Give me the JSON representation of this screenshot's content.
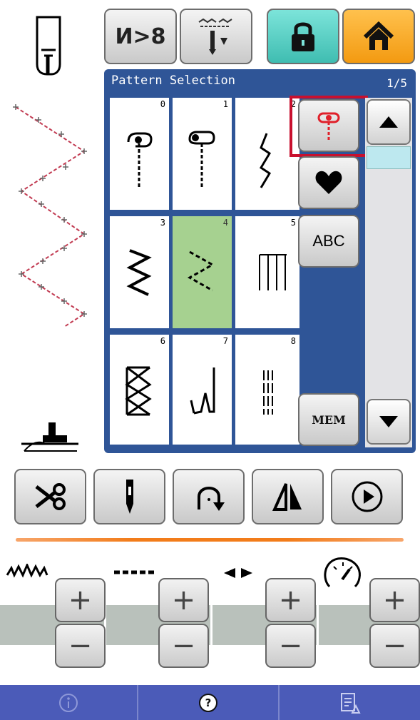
{
  "header": {
    "thread_cut_label": "И>8",
    "lock_color": "#4fd1c5",
    "home_color": "#f6a623"
  },
  "panel": {
    "title": "Pattern Selection",
    "page": "1/5",
    "patterns": [
      {
        "num": "0",
        "icon": "buttonhole-stitch-icon",
        "selected": false
      },
      {
        "num": "1",
        "icon": "keyhole-stitch-icon",
        "selected": false
      },
      {
        "num": "2",
        "icon": "lightning-stitch-icon",
        "selected": false
      },
      {
        "num": "3",
        "icon": "zigzag-stitch-icon",
        "selected": false
      },
      {
        "num": "4",
        "icon": "dashed-zigzag-stitch-icon",
        "selected": true
      },
      {
        "num": "5",
        "icon": "blind-hem-stitch-icon",
        "selected": false
      },
      {
        "num": "6",
        "icon": "overlock-stitch-icon",
        "selected": false
      },
      {
        "num": "7",
        "icon": "blind-stitch-icon",
        "selected": false
      },
      {
        "num": "8",
        "icon": "triple-straight-stitch-icon",
        "selected": false
      }
    ],
    "abc_label": "ABC",
    "mem_label": "MEM"
  },
  "controls": [
    {
      "name": "stitch-width",
      "icon": "zigzag-width-icon",
      "plus": "+",
      "minus": "−"
    },
    {
      "name": "stitch-length",
      "icon": "dash-length-icon",
      "plus": "+",
      "minus": "−"
    },
    {
      "name": "needle-position",
      "icon": "left-right-arrows-icon",
      "plus": "+",
      "minus": "−"
    },
    {
      "name": "speed",
      "icon": "speedometer-icon",
      "plus": "+",
      "minus": "−"
    }
  ],
  "footer": {
    "info_icon": "info-icon",
    "help_icon": "help-icon",
    "help_label": "?",
    "report_icon": "report-icon"
  },
  "colors": {
    "panel_bg": "#2f5597",
    "selected_cell": "#a6d190",
    "highlight_border": "#c8102e",
    "footer_bg": "#4b5bb8",
    "divider": "#f27c1a"
  }
}
